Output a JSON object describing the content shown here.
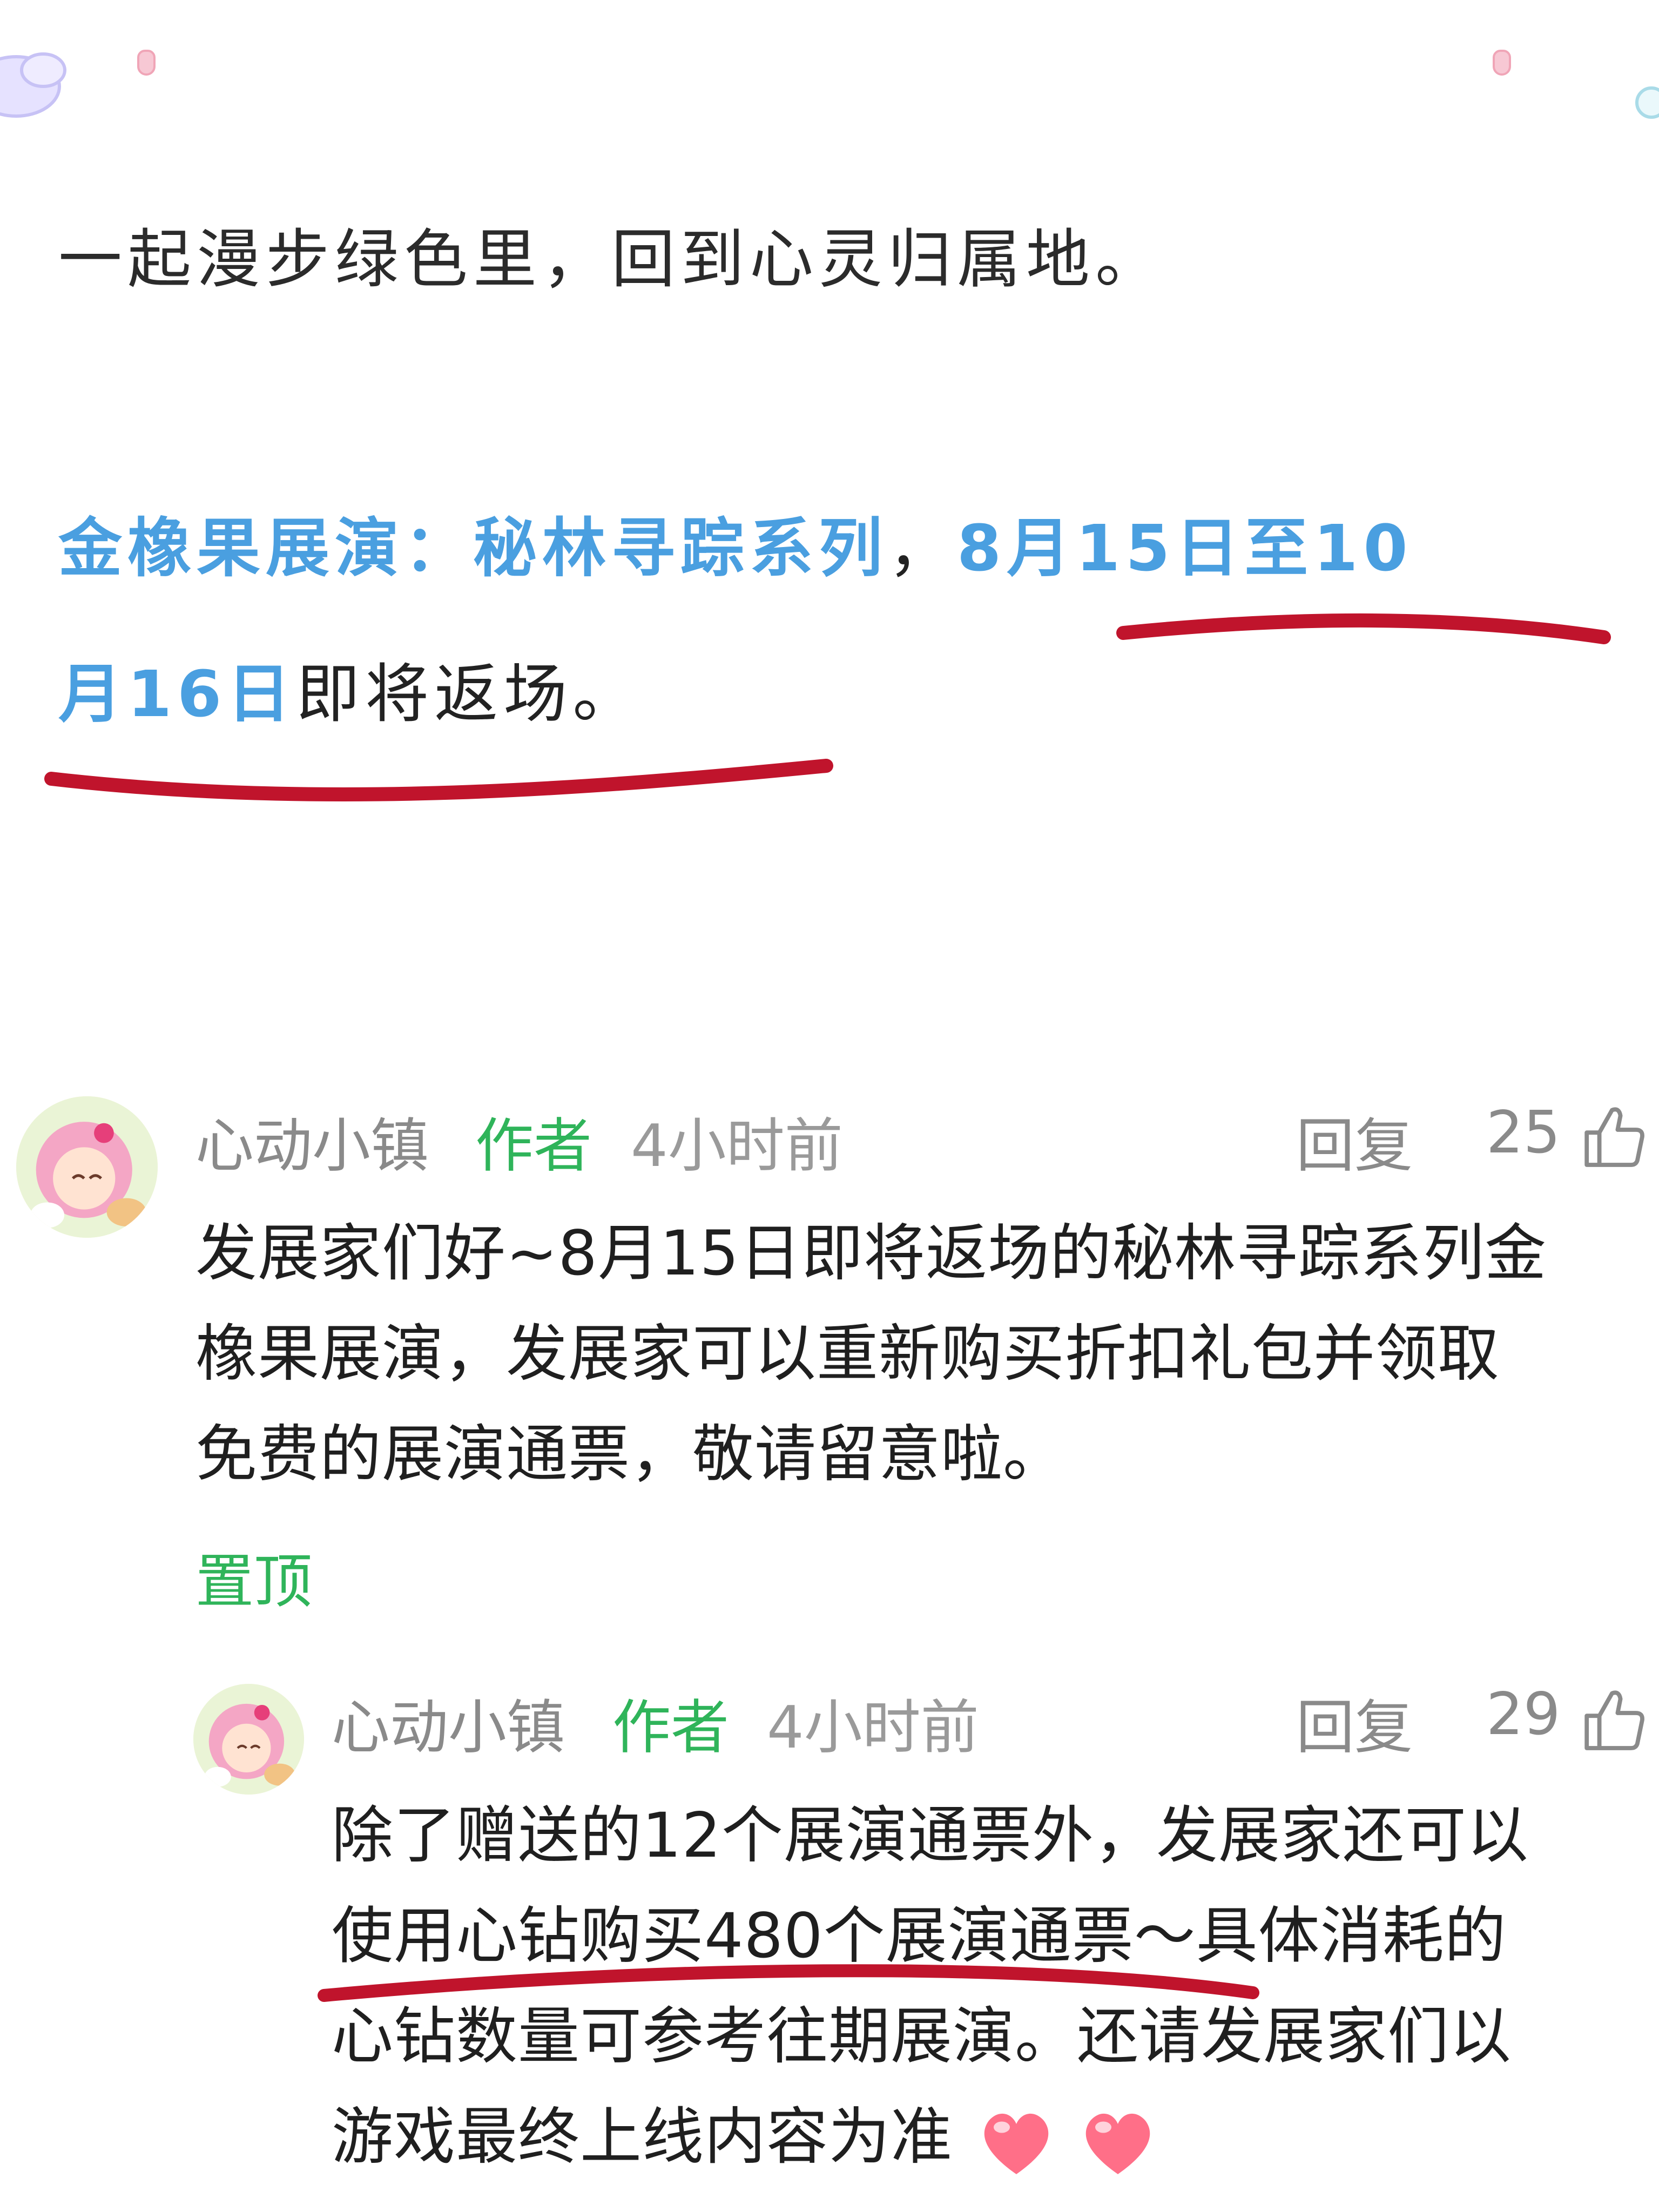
{
  "post": {
    "line1": "一起漫步绿色里，回到心灵归属地。",
    "line2_hl_a": "金橡果展演：秘林寻踪系列",
    "line2_sep": "，",
    "line2_hl_b": "8月15日至10",
    "line3_hl": "月16日",
    "line3_rest": "即将返场。"
  },
  "comments": [
    {
      "author": "心动小镇",
      "badge": "作者",
      "time": "4小时前",
      "reply_label": "回复",
      "likes": "25",
      "lines": [
        "发展家们好~8月15日即将返场的秘林寻踪系列金",
        "橡果展演，发展家可以重新购买折扣礼包并领取",
        "免费的展演通票，敬请留意啦。"
      ],
      "pinned_label": "置顶"
    },
    {
      "author": "心动小镇",
      "badge": "作者",
      "time": "4小时前",
      "reply_label": "回复",
      "likes": "29",
      "lines": [
        "除了赠送的12个展演通票外，发展家还可以",
        "使用心钻购买480个展演通票～具体消耗的",
        "心钻数量可参考往期展演。还请发展家们以",
        "游戏最终上线内容为准"
      ]
    }
  ],
  "colors": {
    "highlight": "#4a9fe0",
    "author_badge": "#2fb45a",
    "underline": "#c0142c"
  },
  "icons": [
    "thumbs-up-icon",
    "heart-icon",
    "avatar"
  ]
}
